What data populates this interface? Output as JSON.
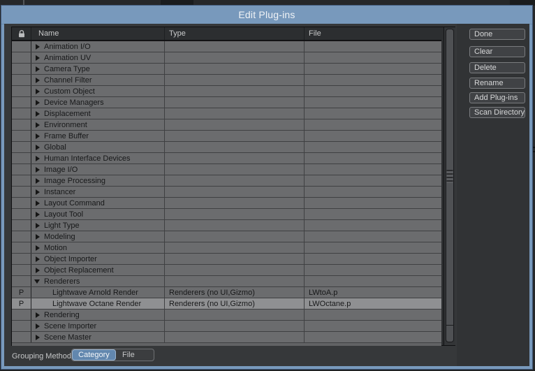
{
  "window": {
    "title": "Edit Plug-ins"
  },
  "plugin_table": {
    "header": {
      "lock": "lock-icon",
      "name": "Name",
      "type": "Type",
      "file": "File"
    },
    "rows": [
      {
        "kind": "category",
        "name": "Animation I/O",
        "expanded": false
      },
      {
        "kind": "category",
        "name": "Animation UV",
        "expanded": false
      },
      {
        "kind": "category",
        "name": "Camera Type",
        "expanded": false
      },
      {
        "kind": "category",
        "name": "Channel Filter",
        "expanded": false
      },
      {
        "kind": "category",
        "name": "Custom Object",
        "expanded": false
      },
      {
        "kind": "category",
        "name": "Device Managers",
        "expanded": false
      },
      {
        "kind": "category",
        "name": "Displacement",
        "expanded": false
      },
      {
        "kind": "category",
        "name": "Environment",
        "expanded": false
      },
      {
        "kind": "category",
        "name": "Frame Buffer",
        "expanded": false
      },
      {
        "kind": "category",
        "name": "Global",
        "expanded": false
      },
      {
        "kind": "category",
        "name": "Human Interface Devices",
        "expanded": false
      },
      {
        "kind": "category",
        "name": "Image I/O",
        "expanded": false
      },
      {
        "kind": "category",
        "name": "Image Processing",
        "expanded": false
      },
      {
        "kind": "category",
        "name": "Instancer",
        "expanded": false
      },
      {
        "kind": "category",
        "name": "Layout Command",
        "expanded": false
      },
      {
        "kind": "category",
        "name": "Layout Tool",
        "expanded": false
      },
      {
        "kind": "category",
        "name": "Light Type",
        "expanded": false
      },
      {
        "kind": "category",
        "name": "Modeling",
        "expanded": false
      },
      {
        "kind": "category",
        "name": "Motion",
        "expanded": false
      },
      {
        "kind": "category",
        "name": "Object Importer",
        "expanded": false
      },
      {
        "kind": "category",
        "name": "Object Replacement",
        "expanded": false
      },
      {
        "kind": "category",
        "name": "Renderers",
        "expanded": true
      },
      {
        "kind": "plugin",
        "lock": "P",
        "name": "Lightwave Arnold Render",
        "type": "Renderers (no UI,Gizmo)",
        "file": "LWtoA.p",
        "selected": false
      },
      {
        "kind": "plugin",
        "lock": "P",
        "name": "Lightwave Octane Render",
        "type": "Renderers (no UI,Gizmo)",
        "file": "LWOctane.p",
        "selected": true
      },
      {
        "kind": "category",
        "name": "Rendering",
        "expanded": false
      },
      {
        "kind": "category",
        "name": "Scene Importer",
        "expanded": false
      },
      {
        "kind": "category",
        "name": "Scene Master",
        "expanded": false
      }
    ]
  },
  "buttons": [
    {
      "id": "done",
      "label": "Done"
    },
    {
      "id": "clear",
      "label": "Clear"
    },
    {
      "id": "delete",
      "label": "Delete"
    },
    {
      "id": "rename",
      "label": "Rename"
    },
    {
      "id": "add-plugins",
      "label": "Add Plug-ins"
    },
    {
      "id": "scan-directory",
      "label": "Scan Directory"
    }
  ],
  "grouping": {
    "label": "Grouping Method",
    "options": [
      {
        "label": "Category",
        "selected": true
      },
      {
        "label": "File",
        "selected": false
      }
    ]
  },
  "colors": {
    "titlebar": "#7899bc",
    "row": "#6b6c6e",
    "row_selected": "#8f9092",
    "grouping_selected": "#6287ae"
  }
}
